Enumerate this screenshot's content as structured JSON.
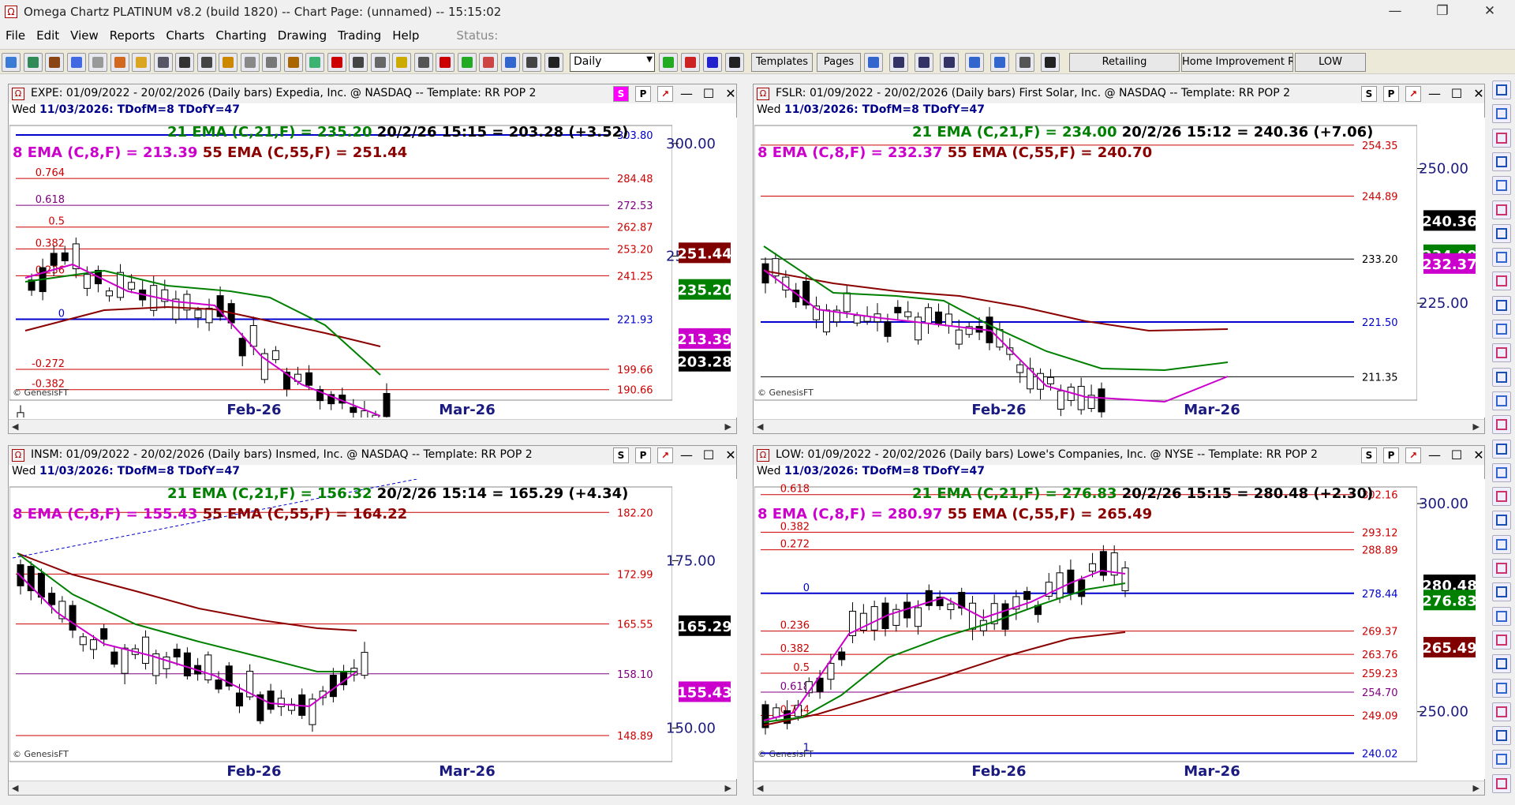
{
  "app": {
    "title": "Omega Chartz PLATINUM v8.2 (build 1820)  --  Chart Page: (unnamed) -- 15:15:02"
  },
  "menu": [
    "File",
    "Edit",
    "View",
    "Reports",
    "Charts",
    "Charting",
    "Drawing",
    "Trading",
    "Help"
  ],
  "status_label": "Status:",
  "toolbar": {
    "period": "Daily",
    "buttons": [
      "Templates",
      "Pages",
      "Retailing",
      "Home Improvement Ret",
      "LOW"
    ]
  },
  "panels": [
    {
      "id": "expe",
      "header": "EXPE: 01/09/2022 - 20/02/2026  (Daily bars)   Expedia, Inc. @ NASDAQ  --  Template: RR POP 2",
      "s_active": true,
      "date": "Wed  11/03/2026:",
      "tdm": "TDofM=8  TDofY=47",
      "ema21": "21 EMA (C,21,F) = 235.20",
      "last": "20/2/26 15:15 = 203.28 (+3.52)",
      "ema8": "8 EMA (C,8,F) = 213.39",
      "ema55": "55 EMA (C,55,F) = 251.44",
      "levels": [
        {
          "label": "",
          "value": "303.80",
          "color": "#0000cc"
        },
        {
          "label": "0.764",
          "value": "284.48",
          "color": "#cc0000"
        },
        {
          "label": "0.618",
          "value": "272.53",
          "color": "#800080"
        },
        {
          "label": "0.5",
          "value": "262.87",
          "color": "#cc0000"
        },
        {
          "label": "0.382",
          "value": "253.20",
          "color": "#cc0000"
        },
        {
          "label": "0.236",
          "value": "241.25",
          "color": "#cc0000"
        },
        {
          "label": "0",
          "value": "221.93",
          "color": "#0000cc"
        },
        {
          "label": "-0.272",
          "value": "199.66",
          "color": "#cc0000"
        },
        {
          "label": "-0.382",
          "value": "190.66",
          "color": "#cc0000"
        }
      ],
      "axis": [
        "300.00",
        "250.00"
      ],
      "tags": [
        {
          "text": "251.44",
          "bg": "#800000"
        },
        {
          "text": "235.20",
          "bg": "#008000"
        },
        {
          "text": "213.39",
          "bg": "#cc00cc"
        },
        {
          "text": "203.28",
          "bg": "#000000"
        }
      ],
      "xlabels": [
        "Feb-26",
        "Mar-26"
      ],
      "copyright": "© GenesisFT"
    },
    {
      "id": "fslr",
      "header": "FSLR: 01/09/2022 - 20/02/2026  (Daily bars)   First Solar, Inc. @ NASDAQ  --  Template: RR POP 2",
      "s_active": false,
      "date": "Wed  11/03/2026:",
      "tdm": "TDofM=8  TDofY=47",
      "ema21": "21 EMA (C,21,F) = 234.00",
      "last": "20/2/26 15:12 = 240.36 (+7.06)",
      "ema8": "8 EMA (C,8,F) = 232.37",
      "ema55": "55 EMA (C,55,F) = 240.70",
      "levels": [
        {
          "label": "",
          "value": "254.35",
          "color": "#cc0000"
        },
        {
          "label": "",
          "value": "244.89",
          "color": "#cc0000"
        },
        {
          "label": "",
          "value": "233.20",
          "color": "#000000"
        },
        {
          "label": "",
          "value": "221.50",
          "color": "#0000cc"
        },
        {
          "label": "",
          "value": "211.35",
          "color": "#000000"
        }
      ],
      "axis": [
        "250.00",
        "225.00"
      ],
      "tags": [
        {
          "text": "240.36",
          "bg": "#000000"
        },
        {
          "text": "234.00",
          "bg": "#008000"
        },
        {
          "text": "232.37",
          "bg": "#cc00cc"
        }
      ],
      "xlabels": [
        "Feb-26",
        "Mar-26"
      ],
      "copyright": "© GenesisFT"
    },
    {
      "id": "insm",
      "header": "INSM: 01/09/2022 - 20/02/2026  (Daily bars)   Insmed, Inc. @ NASDAQ  --  Template: RR POP 2",
      "s_active": false,
      "date": "Wed  11/03/2026:",
      "tdm": "TDofM=8  TDofY=47",
      "ema21": "21 EMA (C,21,F) = 156.32",
      "last": "20/2/26 15:14 = 165.29 (+4.34)",
      "ema8": "8 EMA (C,8,F) = 155.43",
      "ema55": "55 EMA (C,55,F) = 164.22",
      "levels": [
        {
          "label": "",
          "value": "182.20",
          "color": "#cc0000"
        },
        {
          "label": "",
          "value": "172.99",
          "color": "#cc0000"
        },
        {
          "label": "",
          "value": "165.55",
          "color": "#cc0000"
        },
        {
          "label": "",
          "value": "158.10",
          "color": "#800080"
        },
        {
          "label": "",
          "value": "148.89",
          "color": "#cc0000"
        }
      ],
      "axis": [
        "175.00",
        "150.00"
      ],
      "tags": [
        {
          "text": "165.29",
          "bg": "#000000"
        },
        {
          "text": "155.43",
          "bg": "#cc00cc"
        }
      ],
      "xlabels": [
        "Feb-26",
        "Mar-26"
      ],
      "copyright": "© GenesisFT"
    },
    {
      "id": "low",
      "header": "LOW: 01/09/2022 - 20/02/2026  (Daily bars)   Lowe's Companies, Inc. @ NYSE  --  Template: RR POP 2",
      "s_active": false,
      "date": "Wed  11/03/2026:",
      "tdm": "TDofM=8  TDofY=47",
      "ema21": "21 EMA (C,21,F) = 276.83",
      "last": "20/2/26 15:15 = 280.48 (+2.30)",
      "ema8": "8 EMA (C,8,F) = 280.97",
      "ema55": "55 EMA (C,55,F) = 265.49",
      "levels": [
        {
          "label": "0.618",
          "value": "302.16",
          "color": "#cc0000"
        },
        {
          "label": "0.382",
          "value": "293.12",
          "color": "#cc0000"
        },
        {
          "label": "0.272",
          "value": "288.89",
          "color": "#cc0000"
        },
        {
          "label": "0",
          "value": "278.44",
          "color": "#0000cc"
        },
        {
          "label": "0.236",
          "value": "269.37",
          "color": "#cc0000"
        },
        {
          "label": "0.382",
          "value": "263.76",
          "color": "#cc0000"
        },
        {
          "label": "0.5",
          "value": "259.23",
          "color": "#cc0000"
        },
        {
          "label": "0.618",
          "value": "254.70",
          "color": "#800080"
        },
        {
          "label": "0.764",
          "value": "249.09",
          "color": "#cc0000"
        },
        {
          "label": "1",
          "value": "240.02",
          "color": "#0000cc"
        }
      ],
      "axis": [
        "300.00",
        "250.00"
      ],
      "tags": [
        {
          "text": "280.48",
          "bg": "#000000"
        },
        {
          "text": "276.83",
          "bg": "#008000"
        },
        {
          "text": "265.49",
          "bg": "#800000"
        }
      ],
      "xlabels": [
        "Feb-26",
        "Mar-26"
      ],
      "copyright": "© GenesisFT"
    }
  ]
}
